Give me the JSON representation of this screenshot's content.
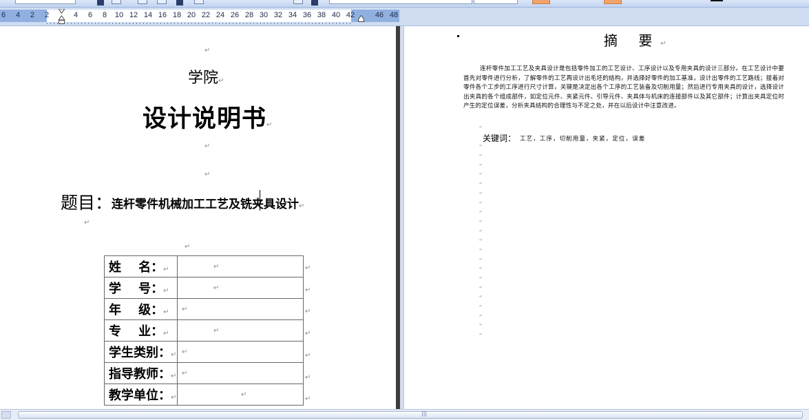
{
  "toolbar": {
    "colors": {
      "accent": "#f2a36b",
      "toolbar_bg": "#c3d5f2"
    }
  },
  "ruler": {
    "labels": [
      "6",
      "4",
      "2",
      "2",
      "4",
      "6",
      "8",
      "10",
      "12",
      "14",
      "16",
      "18",
      "20",
      "22",
      "24",
      "26",
      "28",
      "30",
      "32",
      "34",
      "36",
      "38",
      "40",
      "42",
      "46",
      "48"
    ],
    "marker_icon": "indent-marker-icon"
  },
  "left_page": {
    "school": "学院",
    "title": "设计说明书",
    "topic_label": "题目：",
    "topic_text": "连杆零件机械加工工艺及铣夹具设计",
    "para_mark": "↵",
    "table": {
      "rows": [
        {
          "label": "姓    名："
        },
        {
          "label": "学    号："
        },
        {
          "label": "年    级："
        },
        {
          "label": "专    业："
        },
        {
          "label": "学生类别："
        },
        {
          "label": "指导教师："
        },
        {
          "label": "教学单位："
        }
      ]
    }
  },
  "right_page": {
    "title": "摘 要",
    "body": "连杆零件加工工艺及夹具设计是包括零件加工的工艺设计、工序设计以及专用夹具的设计三部分。在工艺设计中要首先对零件进行分析，了解零件的工艺再设计出毛坯的结构，并选择好零件的加工基准，设计出零件的工艺路线；接着对零件各个工步的工序进行尺寸计算，关键是决定出各个工序的工艺装备及切削用量；然后进行专用夹具的设计，选择设计出夹具的各个组成部件，如定位元件、夹紧元件、引导元件、夹具体与机床的连接部件以及其它部件；计算出夹具定位时产生的定位误差，分析夹具结构的合理性与不足之处，并在以后设计中注意改进。",
    "keywords_label": "关键词：",
    "keywords": "工艺，工序，切削用量，夹紧，定位，误差"
  },
  "scrollbar": {
    "grip": "|||"
  }
}
